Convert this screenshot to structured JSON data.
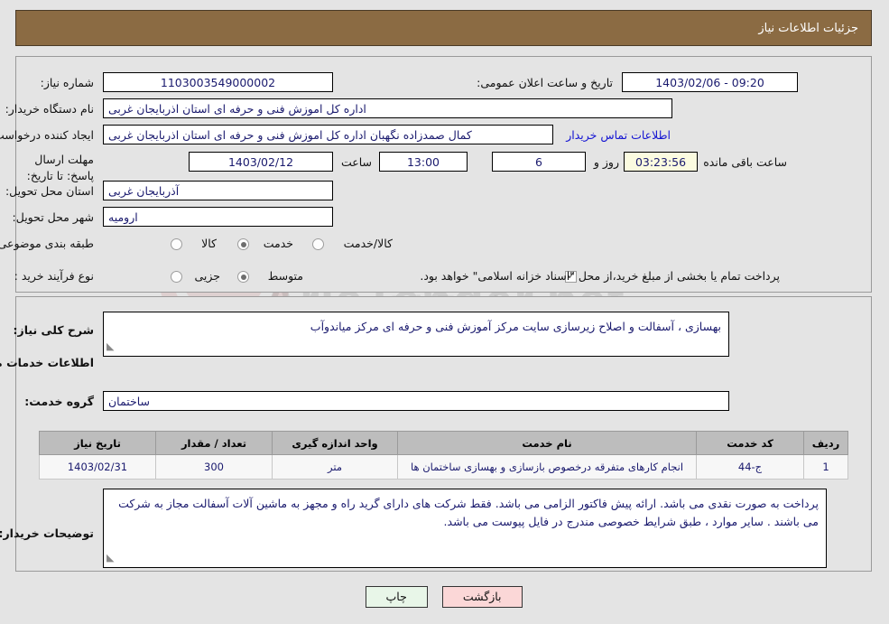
{
  "header": {
    "title": "جزئیات اطلاعات نیاز",
    "bg_color": "#8b6b43"
  },
  "watermark": {
    "text_main": "AriaTender.net",
    "text_sub": "www.AriaTender.net"
  },
  "form": {
    "need_number_label": "شماره نیاز:",
    "need_number_value": "1103003549000002",
    "public_announce_label": "تاریخ و ساعت اعلان عمومی:",
    "public_announce_value": "09:20 - 1403/02/06",
    "buyer_org_label": "نام دستگاه خریدار:",
    "buyer_org_value": "اداره کل اموزش فنی و حرفه ای استان اذربایجان غربی",
    "requester_label": "ایجاد کننده درخواست:",
    "requester_value": "کمال صمدزاده نگهبان اداره کل اموزش فنی و حرفه ای استان اذربایجان غربی",
    "contact_link": "اطلاعات تماس خریدار",
    "deadline_label": "مهلت ارسال پاسخ: تا تاریخ:",
    "deadline_date": "1403/02/12",
    "hour_label": "ساعت",
    "deadline_time": "13:00",
    "days_value": "6",
    "days_label": "روز و",
    "countdown_value": "03:23:56",
    "remaining_label": "ساعت باقی مانده",
    "province_label": "استان محل تحویل:",
    "province_value": "آذربایجان غربی",
    "city_label": "شهر محل تحویل:",
    "city_value": "ارومیه",
    "category_label": "طبقه بندی موضوعی:",
    "category_options": [
      {
        "label": "کالا",
        "selected": false
      },
      {
        "label": "خدمت",
        "selected": true
      },
      {
        "label": "کالا/خدمت",
        "selected": false
      }
    ],
    "process_label": "نوع فرآیند خرید :",
    "process_options": [
      {
        "label": "جزیی",
        "selected": false
      },
      {
        "label": "متوسط",
        "selected": true
      }
    ],
    "treasury_checkbox_checked": true,
    "treasury_text": "پرداخت تمام یا بخشی از مبلغ خرید،از محل \"اسناد خزانه اسلامی\" خواهد بود."
  },
  "details": {
    "general_desc_label": "شرح کلی نیاز:",
    "general_desc_value": "بهسازی ، آسفالت و اصلاح زیرسازی سایت مرکز آموزش فنی و حرفه ای مرکز میاندوآب",
    "services_section_title": "اطلاعات خدمات مورد نیاز",
    "service_group_label": "گروه خدمت:",
    "service_group_value": "ساختمان",
    "buyer_notes_label": "توضیحات خریدار:",
    "buyer_notes_value": "پرداخت به صورت نقدی می باشد. ارائه پیش فاکتور الزامی می باشد. فقط شرکت های دارای گرید راه و مجهز به ماشین آلات آسفالت مجاز به شرکت می باشند . سایر موارد ، طبق شرایط خصوصی مندرج در فایل پیوست می باشد."
  },
  "table": {
    "columns": [
      "ردیف",
      "کد خدمت",
      "نام خدمت",
      "واحد اندازه گیری",
      "تعداد / مقدار",
      "تاریخ نیاز"
    ],
    "rows": [
      {
        "row": "1",
        "service_code": "ج-44",
        "service_name": "انجام کارهای متفرقه درخصوص بازسازی و بهسازی ساختمان ها",
        "unit": "متر",
        "quantity": "300",
        "need_date": "1403/02/31"
      }
    ]
  },
  "buttons": {
    "print": "چاپ",
    "back": "بازگشت"
  }
}
